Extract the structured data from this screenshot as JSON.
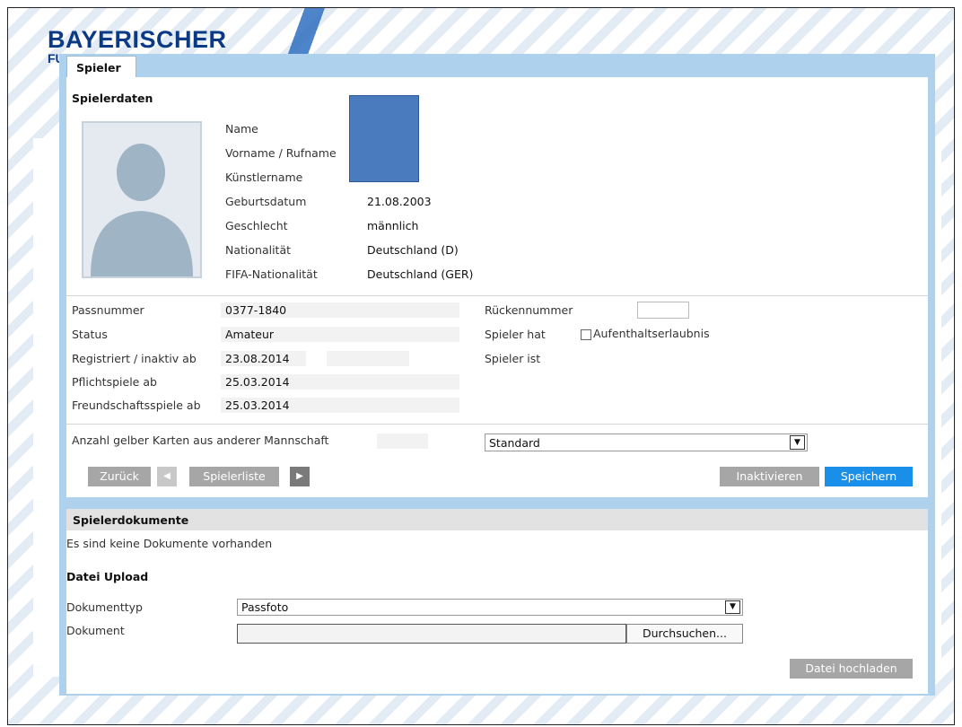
{
  "brand": {
    "logo_text": "BAYERISCHER",
    "logo_sub": "FU"
  },
  "tab": {
    "label": "Spieler"
  },
  "player": {
    "section_title": "Spielerdaten",
    "fields": [
      {
        "label": "Name",
        "value": ""
      },
      {
        "label": "Vorname / Rufname",
        "value": ""
      },
      {
        "label": "Künstlername",
        "value": ""
      },
      {
        "label": "Geburtsdatum",
        "value": "21.08.2003"
      },
      {
        "label": "Geschlecht",
        "value": "männlich"
      },
      {
        "label": "Nationalität",
        "value": "Deutschland (D)"
      },
      {
        "label": "FIFA-Nationalität",
        "value": "Deutschland (GER)"
      }
    ]
  },
  "pass": {
    "rows": [
      {
        "label": "Passnummer",
        "value": "0377-1840"
      },
      {
        "label": "Status",
        "value": "Amateur"
      },
      {
        "label": "Registriert / inaktiv ab",
        "value": "23.08.2014",
        "value2": ""
      },
      {
        "label": "Pflichtspiele ab",
        "value": "25.03.2014"
      },
      {
        "label": "Freundschaftsspiele ab",
        "value": "25.03.2014"
      }
    ],
    "right": {
      "rueckennummer_label": "Rückennummer",
      "rueckennummer_value": "",
      "spieler_hat_label": "Spieler hat",
      "aufenthalt_label": "Aufenthaltserlaubnis",
      "aufenthalt_checked": false,
      "spieler_ist_label": "Spieler ist"
    }
  },
  "cards": {
    "label": "Anzahl gelber Karten aus anderer Mannschaft",
    "value": "",
    "select_value": "Standard"
  },
  "buttons": {
    "back": "Zurück",
    "player_list": "Spielerliste",
    "deactivate": "Inaktivieren",
    "save": "Speichern"
  },
  "documents": {
    "header": "Spielerdokumente",
    "empty_text": "Es sind keine Dokumente vorhanden",
    "upload_title": "Datei Upload",
    "doc_type_label": "Dokumenttyp",
    "doc_type_value": "Passfoto",
    "doc_label": "Dokument",
    "file_value": "",
    "browse_label": "Durchsuchen...",
    "upload_button": "Datei hochladen"
  },
  "colors": {
    "primary_blue": "#1a8fea",
    "button_grey": "#a6a6a6",
    "panel_blue": "#aed1ee",
    "logo_blue": "#0c3b86"
  }
}
